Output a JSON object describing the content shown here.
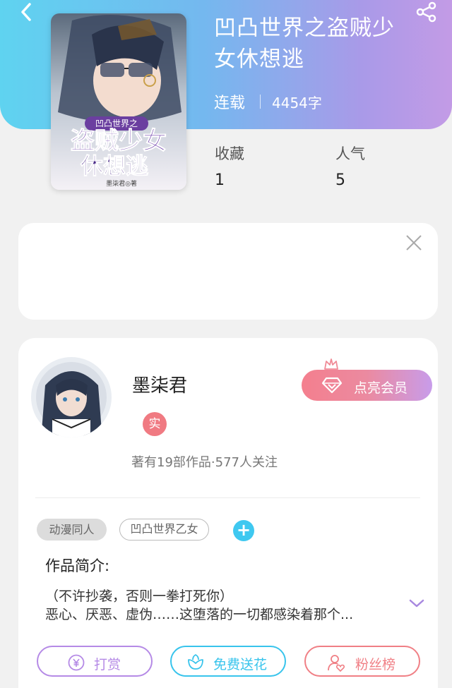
{
  "book": {
    "title_line1": "凹凸世界之盗贼少",
    "title_line2": "女休想逃",
    "status": "连载",
    "word_count": "4454字",
    "cover_series": "凹凸世界之",
    "cover_title_line1": "盗贼少女",
    "cover_title_line2": "休想逃",
    "cover_author": "墨柒君◎著"
  },
  "stats": {
    "favorites_label": "收藏",
    "favorites_value": "1",
    "popularity_label": "人气",
    "popularity_value": "5"
  },
  "author": {
    "name": "墨柒君",
    "verified_label": "实",
    "meta": "著有19部作品·577人关注",
    "vip_button": "点亮会员"
  },
  "tags": [
    "动漫同人",
    "凹凸世界乙女"
  ],
  "intro": {
    "heading": "作品简介:",
    "line1": "（不许抄袭，否则一拳打死你）",
    "line2": "恶心、厌恶、虚伪……这堕落的一切都感染着那个..."
  },
  "actions": {
    "reward": "打赏",
    "flowers": "免费送花",
    "fans": "粉丝榜"
  },
  "colors": {
    "reward": "#b58ae6",
    "flowers": "#38c4ec",
    "fans": "#f07f85",
    "accent_blue": "#3fc8f0"
  },
  "icons": [
    "back-arrow-icon",
    "share-icon",
    "close-icon",
    "crown-icon",
    "diamond-icon",
    "add-icon",
    "chevron-down-icon",
    "yen-icon",
    "flower-icon",
    "user-heart-icon"
  ]
}
